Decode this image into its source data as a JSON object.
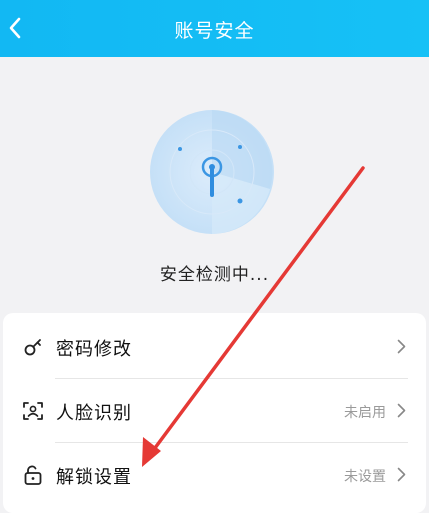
{
  "header": {
    "title": "账号安全",
    "back_icon": "chevron-left-icon"
  },
  "scan": {
    "status": "安全检测中..."
  },
  "settings": {
    "items": [
      {
        "label": "密码修改",
        "value": "",
        "icon": "key-icon"
      },
      {
        "label": "人脸识别",
        "value": "未启用",
        "icon": "face-scan-icon"
      },
      {
        "label": "解锁设置",
        "value": "未设置",
        "icon": "unlock-icon"
      }
    ]
  },
  "colors": {
    "header": "#12b8f3",
    "radar": "#4aa6e8",
    "arrow": "#e53935"
  }
}
